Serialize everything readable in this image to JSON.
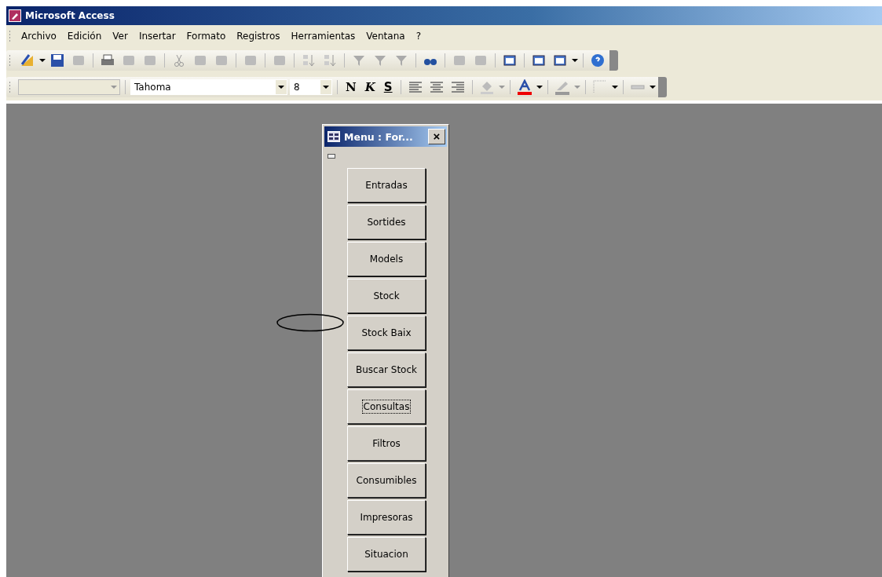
{
  "window": {
    "title": "Microsoft Access"
  },
  "menu_bar": [
    "Archivo",
    "Edición",
    "Ver",
    "Insertar",
    "Formato",
    "Registros",
    "Herramientas",
    "Ventana",
    "?"
  ],
  "format_toolbar": {
    "font_combo": {
      "value": "Tahoma"
    },
    "size_combo": {
      "value": "8"
    },
    "style_buttons": [
      {
        "label": "N",
        "kind": "bold"
      },
      {
        "label": "K",
        "kind": "italic"
      },
      {
        "label": "S",
        "kind": "underline"
      }
    ]
  },
  "form_window": {
    "title": "Menu : For...",
    "close": "×",
    "buttons": [
      {
        "label": "Entradas",
        "focused": false
      },
      {
        "label": "Sortides",
        "focused": false
      },
      {
        "label": "Models",
        "focused": false
      },
      {
        "label": "Stock",
        "focused": false
      },
      {
        "label": "Stock Baix",
        "focused": false
      },
      {
        "label": "Buscar Stock",
        "focused": false
      },
      {
        "label": "Consultas",
        "focused": true
      },
      {
        "label": "Filtros",
        "focused": false
      },
      {
        "label": "Consumibles",
        "focused": false
      },
      {
        "label": "Impresoras",
        "focused": false
      },
      {
        "label": "Situacion",
        "focused": false
      }
    ]
  }
}
